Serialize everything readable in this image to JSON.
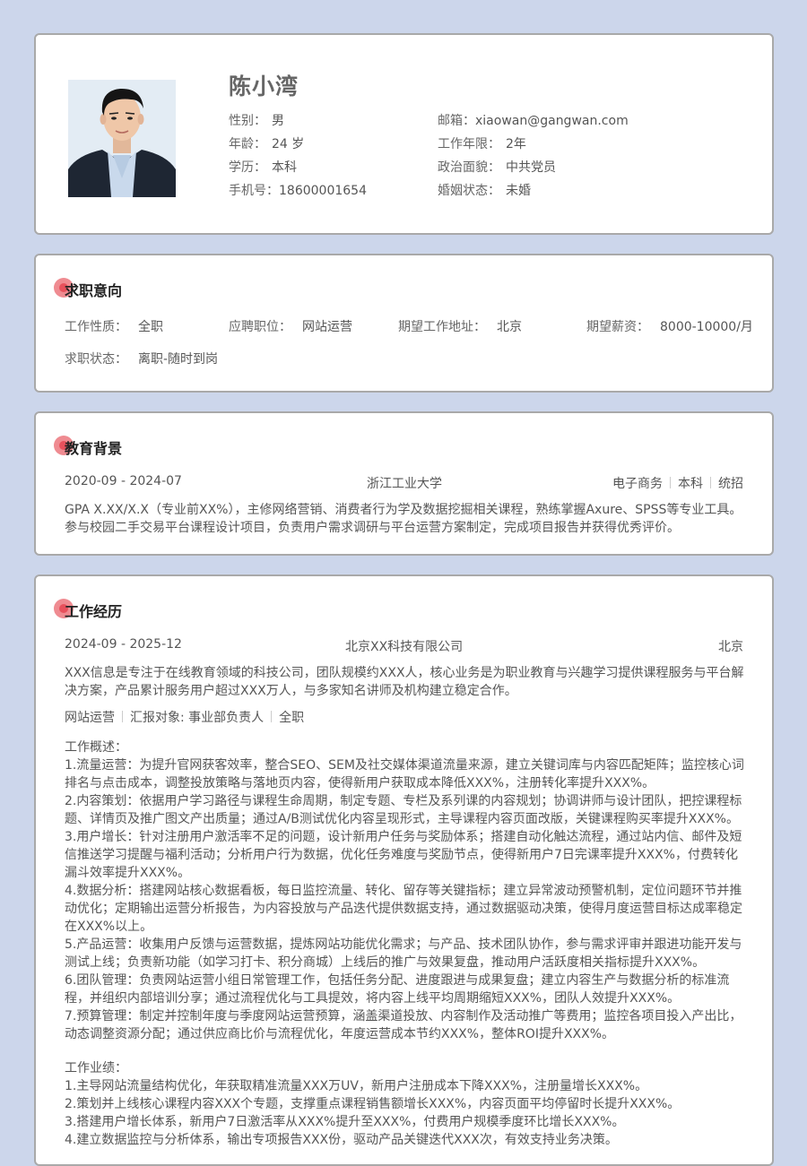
{
  "profile": {
    "name": "陈小湾",
    "gender_label": "性别：",
    "gender": "男",
    "age_label": "年龄：",
    "age": "24 岁",
    "education_label": "学历：",
    "education": "本科",
    "phone_label": "手机号：",
    "phone": "18600001654",
    "email_label": "邮箱：",
    "email": "xiaowan@gangwan.com",
    "years_label": "工作年限：",
    "years": "2年",
    "political_label": "政治面貌：",
    "political": "中共党员",
    "marital_label": "婚姻状态：",
    "marital": "未婚"
  },
  "intent": {
    "title": "求职意向",
    "type_label": "工作性质：",
    "type": "全职",
    "position_label": "应聘职位：",
    "position": "网站运营",
    "location_label": "期望工作地址：",
    "location": "北京",
    "salary_label": "期望薪资：",
    "salary": "8000-10000/月",
    "status_label": "求职状态：",
    "status": "离职-随时到岗"
  },
  "education": {
    "title": "教育背景",
    "period": "2020-09 - 2024-07",
    "school": "浙江工业大学",
    "major": "电子商务",
    "degree": "本科",
    "enroll": "统招",
    "desc_1": "GPA X.XX/X.X（专业前XX%），主修网络营销、消费者行为学及数据挖掘相关课程，熟练掌握Axure、SPSS等专业工具。",
    "desc_2": "参与校园二手交易平台课程设计项目，负责用户需求调研与平台运营方案制定，完成项目报告并获得优秀评价。"
  },
  "work": {
    "title": "工作经历",
    "period": "2024-09 - 2025-12",
    "company": "北京XX科技有限公司",
    "city": "北京",
    "company_desc_1": "XXX信息是专注于在线教育领域的科技公司，团队规模约XXX人，核心业务是为职业教育与兴趣学习提供课程服务与平台解",
    "company_desc_2": "决方案，产品累计服务用户超过XXX万人，与多家知名讲师及机构建立稳定合作。",
    "role": "网站运营",
    "report_to": "汇报对象: 事业部负责人",
    "job_type": "全职",
    "overview_title": "工作概述：",
    "overview_lines": [
      "1.流量运营：为提升官网获客效率，整合SEO、SEM及社交媒体渠道流量来源，建立关键词库与内容匹配矩阵；监控核心词",
      "排名与点击成本，调整投放策略与落地页内容，使得新用户获取成本降低XXX%，注册转化率提升XXX%。",
      "2.内容策划：依据用户学习路径与课程生命周期，制定专题、专栏及系列课的内容规划；协调讲师与设计团队，把控课程标",
      "题、详情页及推广图文产出质量；通过A/B测试优化内容呈现形式，主导课程内容页面改版，关键课程购买率提升XXX%。",
      "3.用户增长：针对注册用户激活率不足的问题，设计新用户任务与奖励体系；搭建自动化触达流程，通过站内信、邮件及短",
      "信推送学习提醒与福利活动；分析用户行为数据，优化任务难度与奖励节点，使得新用户7日完课率提升XXX%，付费转化",
      "漏斗效率提升XXX%。",
      "4.数据分析：搭建网站核心数据看板，每日监控流量、转化、留存等关键指标；建立异常波动预警机制，定位问题环节并推",
      "动优化；定期输出运营分析报告，为内容投放与产品迭代提供数据支持，通过数据驱动决策，使得月度运营目标达成率稳定",
      "在XXX%以上。",
      "5.产品运营：收集用户反馈与运营数据，提炼网站功能优化需求；与产品、技术团队协作，参与需求评审并跟进功能开发与",
      "测试上线；负责新功能（如学习打卡、积分商城）上线后的推广与效果复盘，推动用户活跃度相关指标提升XXX%。",
      "6.团队管理：负责网站运营小组日常管理工作，包括任务分配、进度跟进与成果复盘；建立内容生产与数据分析的标准流",
      "程，并组织内部培训分享；通过流程优化与工具提效，将内容上线平均周期缩短XXX%，团队人效提升XXX%。",
      "7.预算管理：制定并控制年度与季度网站运营预算，涵盖渠道投放、内容制作及活动推广等费用；监控各项目投入产出比，",
      "动态调整资源分配；通过供应商比价与流程优化，年度运营成本节约XXX%，整体ROI提升XXX%。"
    ],
    "achievement_title": "工作业绩：",
    "achievement_lines": [
      "1.主导网站流量结构优化，年获取精准流量XXX万UV，新用户注册成本下降XXX%，注册量增长XXX%。",
      "2.策划并上线核心课程内容XXX个专题，支撑重点课程销售额增长XXX%，内容页面平均停留时长提升XXX%。",
      "3.搭建用户增长体系，新用户7日激活率从XXX%提升至XXX%，付费用户规模季度环比增长XXX%。",
      "4.建立数据监控与分析体系，输出专项报告XXX份，驱动产品关键迭代XXX次，有效支持业务决策。"
    ]
  }
}
